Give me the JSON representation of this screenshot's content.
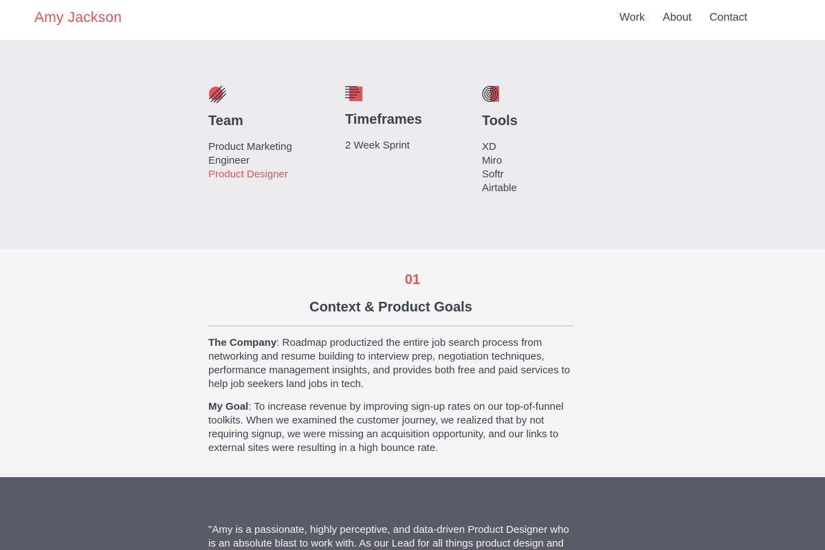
{
  "header": {
    "brand": "Amy Jackson",
    "nav": [
      "Work",
      "About",
      "Contact"
    ]
  },
  "info": {
    "columns": [
      {
        "icon": "diagonal-stripes-circle-icon",
        "title": "Team",
        "items": [
          "Product Marketing",
          "Engineer",
          "Product Designer"
        ],
        "highlight_index": 2
      },
      {
        "icon": "striped-square-icon",
        "title": "Timeframes",
        "items": [
          "2 Week Sprint"
        ]
      },
      {
        "icon": "concentric-circles-icon",
        "title": "Tools",
        "items": [
          "XD",
          "Miro",
          "Softr",
          "Airtable"
        ]
      }
    ]
  },
  "section": {
    "number": "01",
    "heading": "Context & Product Goals",
    "company_label": "The Company",
    "company_text": ": Roadmap productized the entire job search process from networking and resume building to interview prep, negotiation techniques, performance management insights, and provides both free and paid services to help job seekers land jobs in tech.",
    "goal_label": "My Goal",
    "goal_text": ": To increase revenue by improving sign-up rates on our top-of-funnel toolkits. When we examined the customer journey, we realized that by not requiring signup, we were missing an acquisition opportunity, and our links to external sites were resulting in a high bounce rate."
  },
  "testimonial": {
    "text": "\"Amy is a passionate, highly perceptive, and data-driven Product Designer who is an absolute blast to work with. As our Lead for all things product design and"
  },
  "colors": {
    "accent": "#e2545b",
    "info_bg": "#ececee",
    "section_bg": "#f5f5f5",
    "quote_bg": "#585c67"
  }
}
